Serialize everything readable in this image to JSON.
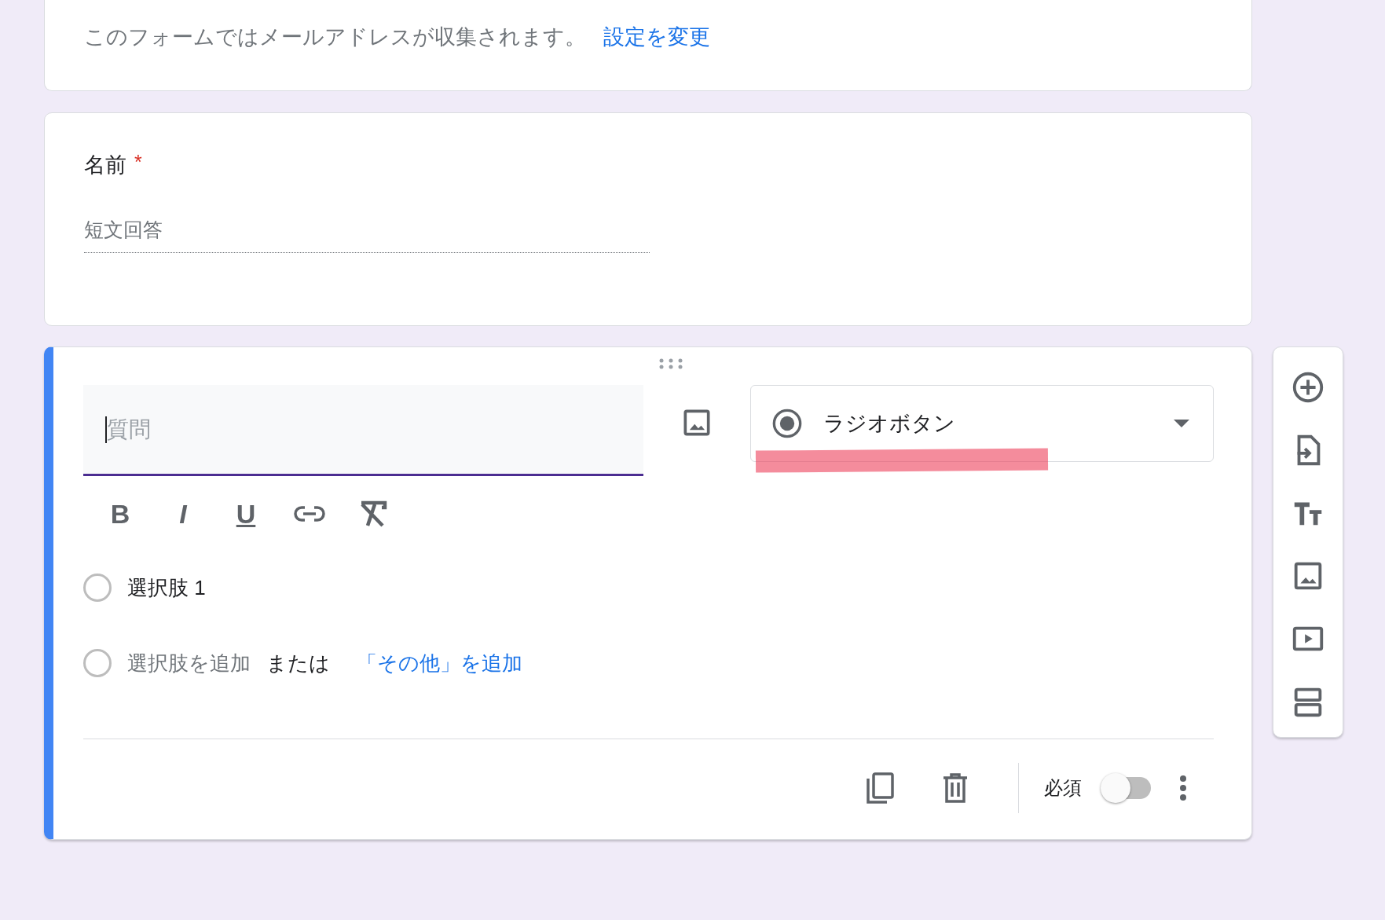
{
  "notice": {
    "text": "このフォームではメールアドレスが収集されます。",
    "link": "設定を変更"
  },
  "name_question": {
    "title": "名前",
    "required_mark": "*",
    "placeholder": "短文回答"
  },
  "editor": {
    "question": {
      "placeholder": "質問",
      "focused": true
    },
    "type_dropdown": {
      "label": "ラジオボタン"
    },
    "format_glyphs": [
      "B",
      "I",
      "U"
    ],
    "options": [
      {
        "label": "選択肢 1"
      }
    ],
    "add_option": {
      "placeholder": "選択肢を追加",
      "or_text": "または",
      "add_other": "「その他」を追加"
    },
    "footer": {
      "required_label": "必須",
      "required_on": false
    }
  }
}
